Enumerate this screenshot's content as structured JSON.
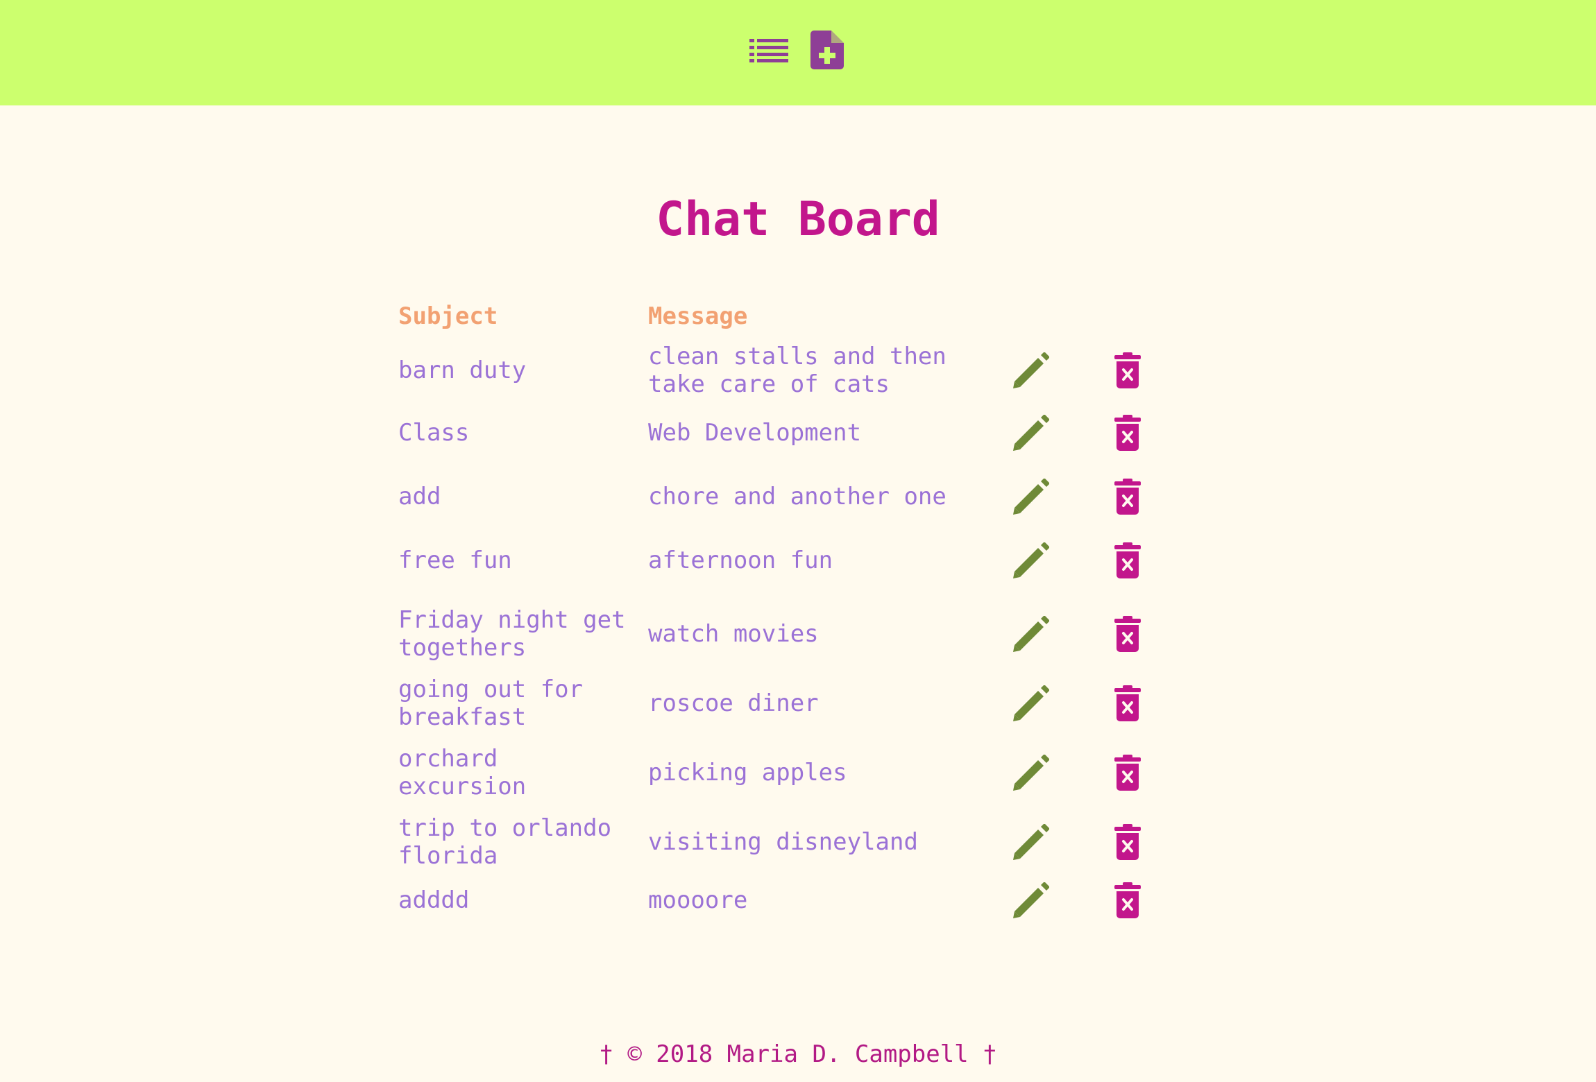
{
  "colors": {
    "header_bg": "#ccff6e",
    "page_bg": "#fffaee",
    "title": "#c2168c",
    "column_header": "#f2a172",
    "cell_text": "#9b72d6",
    "edit_icon": "#6f8a37",
    "delete_icon": "#c2168c",
    "nav_icon": "#8e3f96",
    "footer": "#b21a85"
  },
  "nav": {
    "list_icon": "list-icon",
    "add_icon": "file-plus-icon"
  },
  "page_title": "Chat Board",
  "table": {
    "headers": {
      "subject": "Subject",
      "message": "Message"
    },
    "row_icons": {
      "edit": "pencil-icon",
      "delete": "trash-x-icon"
    },
    "rows": [
      {
        "subject": "barn duty",
        "message": "clean stalls and then\ntake care of cats"
      },
      {
        "subject": "Class",
        "message": "Web Development"
      },
      {
        "subject": "add",
        "message": "chore and another one"
      },
      {
        "subject": "free fun",
        "message": "afternoon fun"
      },
      {
        "subject": "Friday night get\ntogethers",
        "message": "watch movies"
      },
      {
        "subject": "going out for\nbreakfast",
        "message": "roscoe diner"
      },
      {
        "subject": "orchard\nexcursion",
        "message": "picking apples"
      },
      {
        "subject": "trip to orlando\nflorida",
        "message": "visiting disneyland"
      },
      {
        "subject": "adddd",
        "message": "moooore"
      }
    ]
  },
  "footer": "† © 2018 Maria D. Campbell †"
}
